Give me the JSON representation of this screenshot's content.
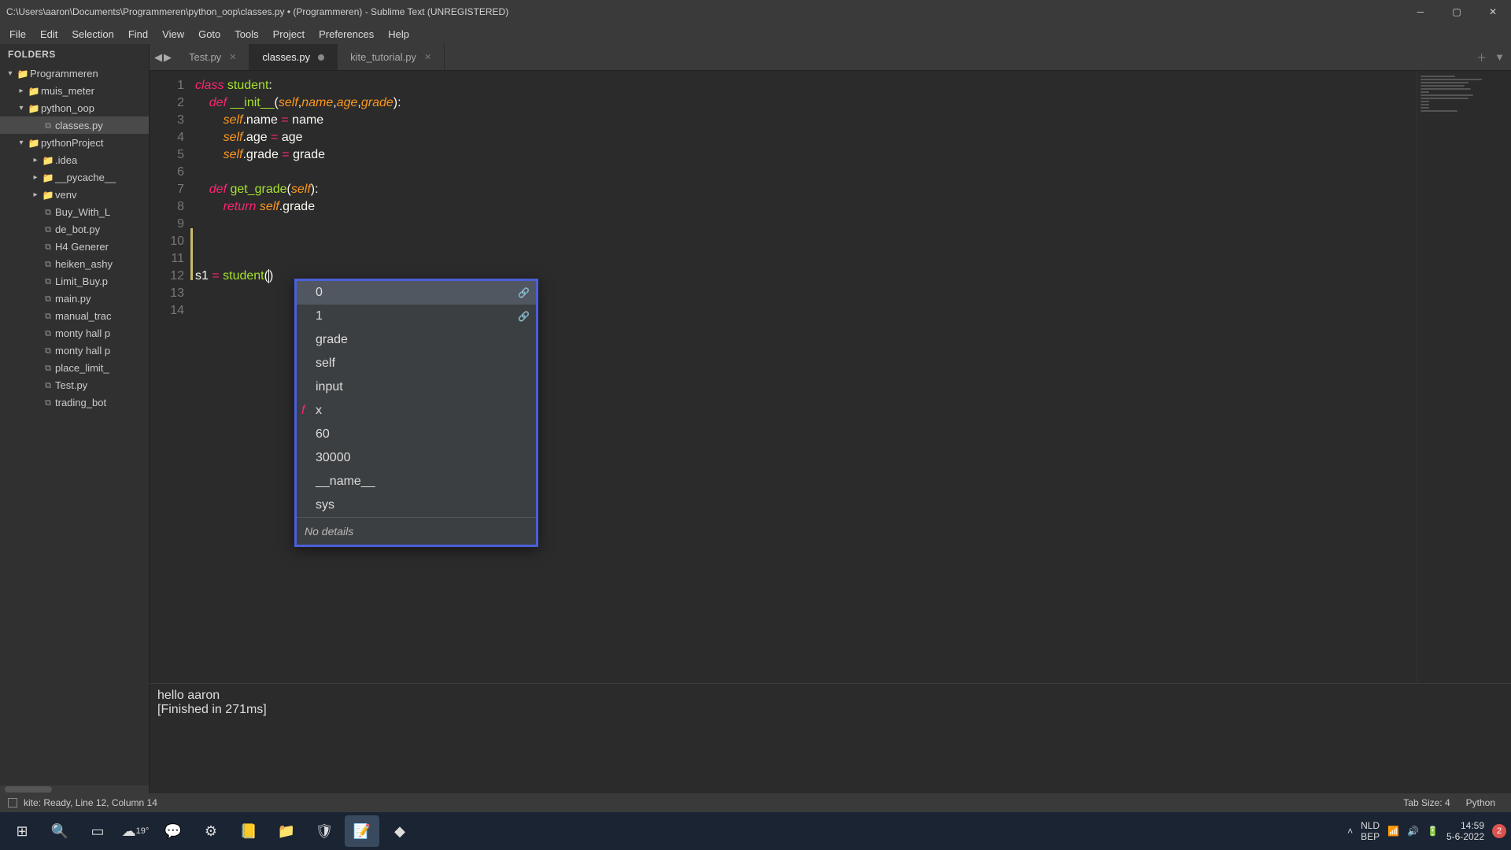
{
  "titlebar": {
    "title": "C:\\Users\\aaron\\Documents\\Programmeren\\python_oop\\classes.py • (Programmeren) - Sublime Text (UNREGISTERED)"
  },
  "menu": [
    "File",
    "Edit",
    "Selection",
    "Find",
    "View",
    "Goto",
    "Tools",
    "Project",
    "Preferences",
    "Help"
  ],
  "sidebar": {
    "header": "FOLDERS",
    "tree": [
      {
        "depth": 0,
        "arrow": "▾",
        "icon": "folder",
        "label": "Programmeren"
      },
      {
        "depth": 1,
        "arrow": "▸",
        "icon": "folder",
        "label": "muis_meter"
      },
      {
        "depth": 1,
        "arrow": "▾",
        "icon": "folder",
        "label": "python_oop"
      },
      {
        "depth": 2,
        "arrow": "",
        "icon": "file",
        "label": "classes.py",
        "selected": true
      },
      {
        "depth": 1,
        "arrow": "▾",
        "icon": "folder",
        "label": "pythonProject"
      },
      {
        "depth": 2,
        "arrow": "▸",
        "icon": "folder",
        "label": ".idea"
      },
      {
        "depth": 2,
        "arrow": "▸",
        "icon": "folder",
        "label": "__pycache__"
      },
      {
        "depth": 2,
        "arrow": "▸",
        "icon": "folder",
        "label": "venv"
      },
      {
        "depth": 2,
        "arrow": "",
        "icon": "file",
        "label": "Buy_With_L"
      },
      {
        "depth": 2,
        "arrow": "",
        "icon": "file",
        "label": "de_bot.py"
      },
      {
        "depth": 2,
        "arrow": "",
        "icon": "file",
        "label": "H4 Generer"
      },
      {
        "depth": 2,
        "arrow": "",
        "icon": "file",
        "label": "heiken_ashy"
      },
      {
        "depth": 2,
        "arrow": "",
        "icon": "file",
        "label": "Limit_Buy.p"
      },
      {
        "depth": 2,
        "arrow": "",
        "icon": "file",
        "label": "main.py"
      },
      {
        "depth": 2,
        "arrow": "",
        "icon": "file",
        "label": "manual_trac"
      },
      {
        "depth": 2,
        "arrow": "",
        "icon": "file",
        "label": "monty hall p"
      },
      {
        "depth": 2,
        "arrow": "",
        "icon": "file",
        "label": "monty hall p"
      },
      {
        "depth": 2,
        "arrow": "",
        "icon": "file",
        "label": "place_limit_"
      },
      {
        "depth": 2,
        "arrow": "",
        "icon": "file",
        "label": "Test.py"
      },
      {
        "depth": 2,
        "arrow": "",
        "icon": "file",
        "label": "trading_bot"
      }
    ]
  },
  "tabs": [
    {
      "label": "Test.py",
      "active": false,
      "dirty": false
    },
    {
      "label": "classes.py",
      "active": true,
      "dirty": true
    },
    {
      "label": "kite_tutorial.py",
      "active": false,
      "dirty": false
    }
  ],
  "gutter_lines": [
    "1",
    "2",
    "3",
    "4",
    "5",
    "6",
    "7",
    "8",
    "9",
    "10",
    "11",
    "12",
    "13",
    "14"
  ],
  "autocomplete": {
    "items": [
      {
        "label": "0",
        "link": true,
        "selected": true
      },
      {
        "label": "1",
        "link": true
      },
      {
        "label": "grade"
      },
      {
        "label": "self"
      },
      {
        "label": "input"
      },
      {
        "label": "x",
        "f": true
      },
      {
        "label": "60"
      },
      {
        "label": "30000"
      },
      {
        "label": "__name__"
      },
      {
        "label": "sys"
      }
    ],
    "footer": "No details"
  },
  "console": {
    "line1": "hello aaron",
    "line2": "[Finished in 271ms]"
  },
  "statusbar": {
    "kite": "kite: Ready, Line 12, Column 14",
    "tabsize": "Tab Size: 4",
    "lang": "Python"
  },
  "taskbar": {
    "weather": "19°",
    "lang1": "NLD",
    "lang2": "BEP",
    "time": "14:59",
    "date": "5-6-2022",
    "notif": "2"
  }
}
